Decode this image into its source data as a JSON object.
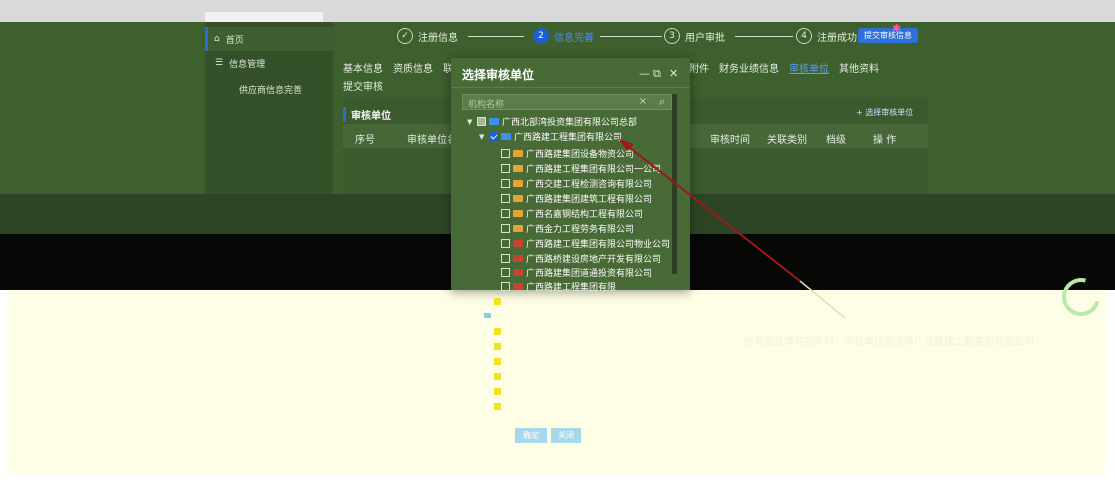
{
  "sidebar": {
    "items": [
      {
        "icon": "home-icon",
        "label": "首页"
      },
      {
        "icon": "database-icon",
        "label": "信息管理"
      },
      {
        "icon": "",
        "label": "供应商信息完善"
      }
    ]
  },
  "steps": [
    {
      "index": "✓",
      "label": "注册信息",
      "state": "done"
    },
    {
      "index": "2",
      "label": "信息完善",
      "state": "active"
    },
    {
      "index": "3",
      "label": "用户审批",
      "state": "pending"
    },
    {
      "index": "4",
      "label": "注册成功",
      "state": "pending"
    }
  ],
  "step_button": "提交审核信息",
  "tabs": {
    "left": [
      "基本信息",
      "资质信息",
      "联"
    ],
    "right": [
      "附件",
      "财务业绩信息",
      "审核单位",
      "其他资料"
    ],
    "active": "审核单位",
    "submit": "提交审核"
  },
  "panel": {
    "title": "审核单位",
    "add_button": "+ 选择审核单位",
    "columns": [
      "序号",
      "审核单位名",
      "审核时间",
      "关联类别",
      "档级",
      "操 作"
    ]
  },
  "modal": {
    "title": "选择审核单位",
    "controls": [
      "—",
      "⧉",
      "✕"
    ],
    "search_placeholder": "机构名称",
    "tree": [
      {
        "label": "广西北部湾投资集团有限公司总部",
        "level": 0,
        "checkbox": "half",
        "expanded": true,
        "folder": "blue"
      },
      {
        "label": "广西路建工程集团有限公司",
        "level": 1,
        "checkbox": "checked",
        "expanded": true,
        "folder": "blue"
      },
      {
        "label": "广西路建集团设备物资公司",
        "level": 2,
        "checkbox": "unchecked",
        "folder": "orange"
      },
      {
        "label": "广西路建工程集团有限公司一公司",
        "level": 2,
        "checkbox": "unchecked",
        "folder": "orange"
      },
      {
        "label": "广西交建工程检测咨询有限公司",
        "level": 2,
        "checkbox": "unchecked",
        "folder": "orange"
      },
      {
        "label": "广西路建集团建筑工程有限公司",
        "level": 2,
        "checkbox": "unchecked",
        "folder": "orange"
      },
      {
        "label": "广西名嘉钢结构工程有限公司",
        "level": 2,
        "checkbox": "unchecked",
        "folder": "orange"
      },
      {
        "label": "广西金力工程劳务有限公司",
        "level": 2,
        "checkbox": "unchecked",
        "folder": "orange"
      },
      {
        "label": "广西路建工程集团有限公司物业公司",
        "level": 2,
        "checkbox": "unchecked",
        "folder": "red"
      },
      {
        "label": "广西路桥建设房地产开发有限公司",
        "level": 2,
        "checkbox": "unchecked",
        "folder": "red"
      },
      {
        "label": "广西路建集团道通投资有限公司",
        "level": 2,
        "checkbox": "unchecked",
        "folder": "red"
      },
      {
        "label": "广西路建工程集团有限",
        "level": 2,
        "checkbox": "unchecked",
        "folder": "red"
      }
    ],
    "confirm_label": "确定",
    "close_label": "关闭"
  },
  "tip": "所有信息填写完毕时，审核单位请选择广西路建工程集团有限公司",
  "colors": {
    "accent": "#1c5fd0",
    "annotation_arrow": "#a01818"
  }
}
